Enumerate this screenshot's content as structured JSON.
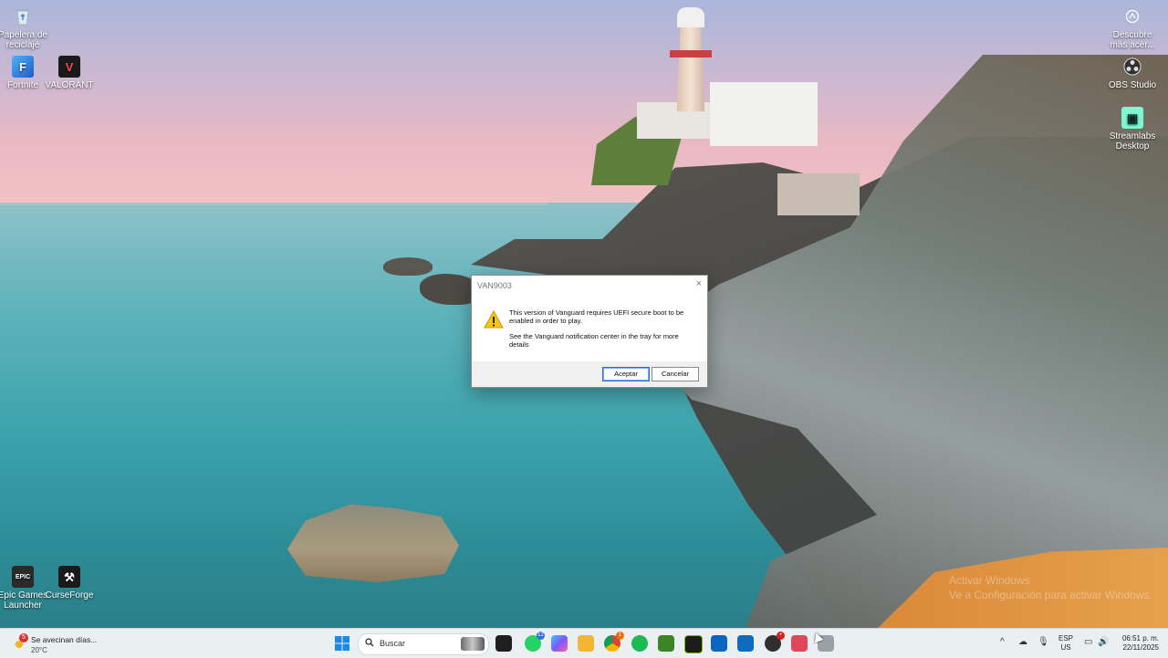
{
  "desktop": {
    "icons_left": [
      {
        "label": "Papelera de reciclaje",
        "icon": "recycle-bin-icon"
      },
      {
        "label": "Fortnite",
        "icon": "fortnite-icon"
      },
      {
        "label": "VALORANT",
        "icon": "valorant-icon"
      },
      {
        "label": "Epic Games Launcher",
        "icon": "epic-games-icon"
      },
      {
        "label": "CurseForge",
        "icon": "curseforge-icon"
      }
    ],
    "icons_right": [
      {
        "label": "Descubre más acer...",
        "icon": "discover-icon"
      },
      {
        "label": "OBS Studio",
        "icon": "obs-icon"
      },
      {
        "label": "Streamlabs Desktop",
        "icon": "streamlabs-icon"
      }
    ],
    "watermark_line1": "Activar Windows",
    "watermark_line2": "Ve a Configuración para activar Windows."
  },
  "dialog": {
    "title": "VAN9003",
    "close_glyph": "×",
    "message_line1": "This version of Vanguard requires UEFI secure boot to be enabled in order to play.",
    "message_line2": "See the Vanguard notification center in the tray for more details",
    "accept_label": "Aceptar",
    "cancel_label": "Cancelar",
    "icon": "warning-icon"
  },
  "taskbar": {
    "weather": {
      "text": "Se avecinan días...",
      "temp": "20°C",
      "badge": "5"
    },
    "search_placeholder": "Buscar",
    "apps": [
      {
        "name": "task-view",
        "color": "#1f1f1f",
        "badge": ""
      },
      {
        "name": "whatsapp",
        "color": "#25d366",
        "badge": "12"
      },
      {
        "name": "copilot",
        "color": "#7a5af8",
        "badge": ""
      },
      {
        "name": "file-explorer",
        "color": "#f2b632",
        "badge": ""
      },
      {
        "name": "chrome",
        "color": "#db4437",
        "badge": "1"
      },
      {
        "name": "spotify",
        "color": "#1db954",
        "badge": ""
      },
      {
        "name": "minecraft",
        "color": "#3c8527",
        "badge": ""
      },
      {
        "name": "nvidia",
        "color": "#76b900",
        "badge": ""
      },
      {
        "name": "store",
        "color": "#0a66c2",
        "badge": ""
      },
      {
        "name": "outlook",
        "color": "#0f6cbd",
        "badge": ""
      },
      {
        "name": "obs",
        "color": "#302e31",
        "badge": "•"
      },
      {
        "name": "valorant",
        "color": "#e0475a",
        "badge": ""
      },
      {
        "name": "vanguard-window",
        "color": "#9aa0a6",
        "badge": ""
      }
    ],
    "tray": {
      "chevron": "^",
      "lang_line1": "ESP",
      "lang_line2": "US",
      "time": "06:51 p. m.",
      "date": "22/11/2025"
    }
  }
}
